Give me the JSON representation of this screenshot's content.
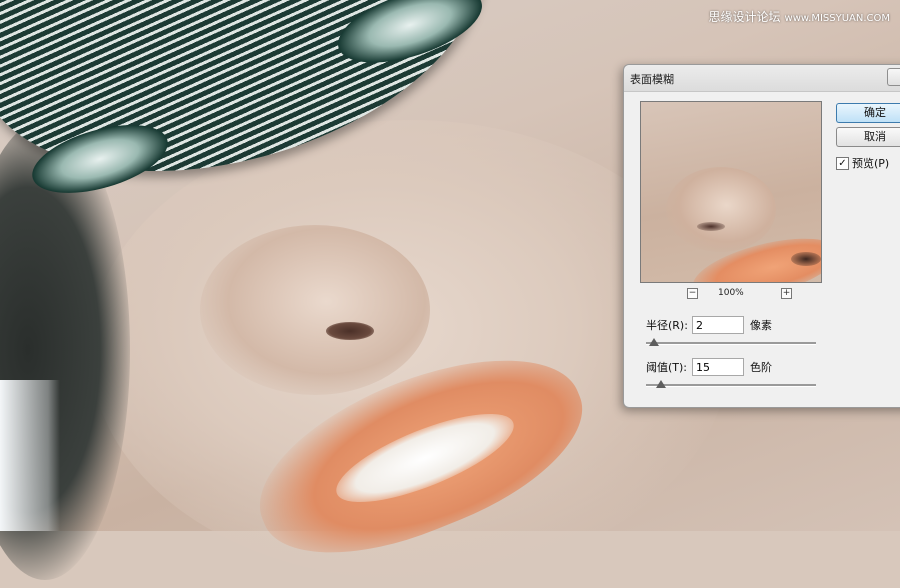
{
  "watermark": {
    "text": "思缘设计论坛",
    "site": "www.MISSYUAN.COM"
  },
  "dialog": {
    "title": "表面模糊",
    "ok_label": "确定",
    "cancel_label": "取消",
    "preview_label": "预览(P)",
    "preview_checked": true,
    "zoom": {
      "minus": "−",
      "level": "100%",
      "plus": "+"
    },
    "radius": {
      "label": "半径(R):",
      "value": "2",
      "unit": "像素",
      "slider_fraction": 0.02
    },
    "threshold": {
      "label": "阈值(T):",
      "value": "15",
      "unit": "色阶",
      "slider_fraction": 0.06
    }
  },
  "colors": {
    "ok_button_border": "#3d7bad",
    "ok_button_fill": "#bfe1f7",
    "dialog_bg": "#f0f0f0"
  }
}
